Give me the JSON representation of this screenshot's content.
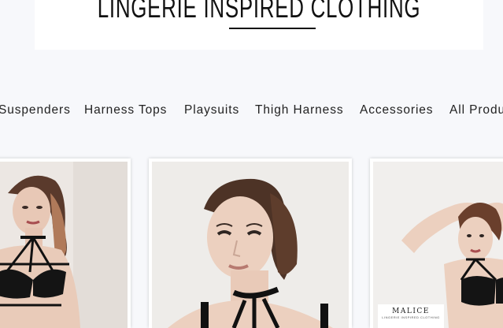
{
  "header": {
    "brand_title": "LINGERIE INSPIRED CLOTHING"
  },
  "nav": {
    "items": [
      {
        "label": "Suspenders"
      },
      {
        "label": "Harness Tops"
      },
      {
        "label": "Playsuits"
      },
      {
        "label": "Thigh Harness"
      },
      {
        "label": "Accessories"
      },
      {
        "label": "All Products"
      }
    ]
  },
  "products": [
    {
      "image": "model-black-harness-bra"
    },
    {
      "image": "model-harness-choker"
    },
    {
      "image": "model-arms-raised-harness",
      "logo": "MALICE",
      "logo_sub": "LINGERIE INSPIRED CLOTHING"
    }
  ],
  "colors": {
    "page_bg": "#f7f8fb",
    "text": "#222222",
    "harness": "#111111"
  }
}
